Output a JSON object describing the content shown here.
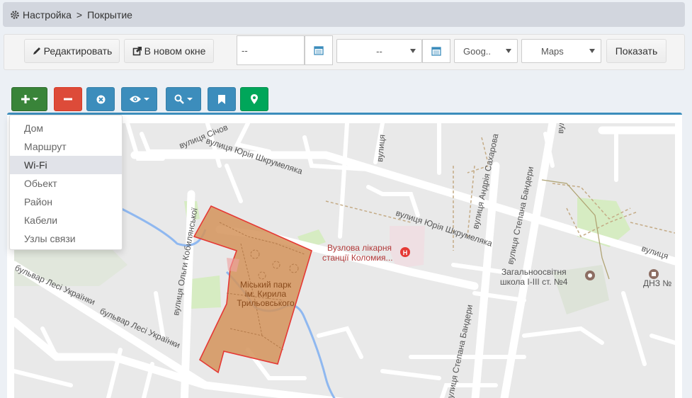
{
  "breadcrumb": {
    "root": "Настройка",
    "separator": ">",
    "current": "Покрытие"
  },
  "toolbar": {
    "edit_label": "Редактировать",
    "new_window_label": "В новом окне",
    "date_from_value": "--",
    "date_to_value": "--",
    "provider_value": "Goog..",
    "map_type_value": "Maps",
    "show_label": "Показать"
  },
  "menu": {
    "items": [
      "Дом",
      "Маршрут",
      "Wi-Fi",
      "Обьект",
      "Район",
      "Кабели",
      "Узлы связи"
    ],
    "active_index": 2
  },
  "map": {
    "streets": {
      "sichovykh": "вулиця Січов",
      "shkrumeliaka1": "вулиця Юрія Шкрумеляка",
      "shkrumeliaka2": "вулиця Юрія Шкрумеляка",
      "kobylianskoi": "вулиця Ольги Кобилянської",
      "lesi1": "бульвар Лесі Українки",
      "lesi2": "бульвар Лесі Українки",
      "sakharova": "вулиця Андрія Сахарова",
      "bandery1": "вулиця Степана Бандери",
      "bandery2": "вулиця Степана Бандери",
      "bandery3": "вулиця Степана Бандери",
      "vulytsia": "вулиця",
      "vulytsia2": "вулиця",
      "vulytsia_right": "вулиця"
    },
    "park_line1": "Міський парк",
    "park_line2": "ім. Кирила",
    "park_line3": "Трильовського",
    "hospital_line1": "Вузлова лікарня",
    "hospital_line2": "станції Коломия...",
    "school_line1": "Загальноосвітня",
    "school_line2": "школа I-III ст. №4",
    "dnz": "ДНЗ №",
    "colors": {
      "polygon_fill": "#d4935a",
      "polygon_stroke": "#e53935",
      "park_green": "#cfe8b8",
      "water": "#8fb8f0"
    }
  }
}
